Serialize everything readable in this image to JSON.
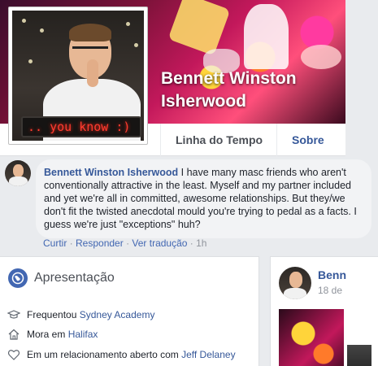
{
  "profile": {
    "name": "Bennett Winston Isherwood",
    "avatar_sign_text": ".. you know :)",
    "tabs": [
      "Linha do Tempo",
      "Sobre"
    ]
  },
  "comment": {
    "author": "Bennett Winston Isherwood",
    "text": "I have many masc friends who aren't conventionally attractive in the least. Myself and my partner included and yet we're all in committed, awesome relationships. But they/we don't fit the twisted anecdotal mould you're trying to pedal as a facts. I guess we're just \"exceptions\" huh?",
    "actions": {
      "like": "Curtir",
      "separator": " · ",
      "reply": "Responder",
      "translate": "Ver tradução",
      "time": "1h"
    }
  },
  "intro": {
    "title": "Apresentação",
    "items": [
      {
        "icon": "graduation-cap-icon",
        "prefix": "Frequentou ",
        "link": "Sydney Academy"
      },
      {
        "icon": "home-icon",
        "prefix": "Mora em ",
        "link": "Halifax"
      },
      {
        "icon": "heart-icon",
        "prefix": "Em um relacionamento aberto com ",
        "link": "Jeff Delaney"
      }
    ]
  },
  "post_preview": {
    "author": "Benn",
    "date": "18 de"
  },
  "colors": {
    "link": "#365899",
    "background": "#e9ebee",
    "bubble": "#f2f3f5",
    "led_text": "#ff3b2f"
  }
}
